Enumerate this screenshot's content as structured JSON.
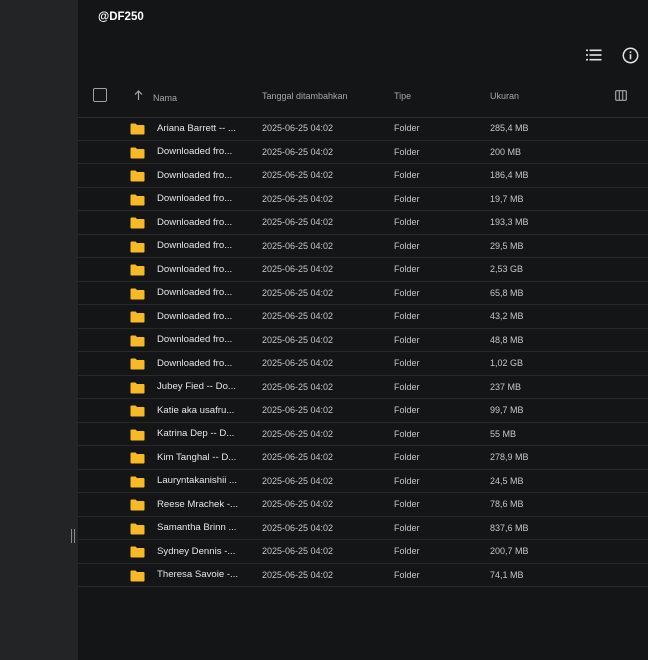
{
  "title": "@DF250",
  "header": {
    "name": "Nama",
    "date": "Tanggal ditambahkan",
    "type": "Tipe",
    "size": "Ukuran"
  },
  "icons": {
    "list_view": "list-icon",
    "info": "info-icon",
    "sort": "arrow-up-icon",
    "columns": "columns-icon",
    "folder": "folder-icon",
    "folder_color": "#f7b924"
  },
  "rows": [
    {
      "name": "Ariana Barrett -- ...",
      "date": "2025-06-25 04:02",
      "type": "Folder",
      "size": "285,4 MB"
    },
    {
      "name": "Downloaded fro...",
      "date": "2025-06-25 04:02",
      "type": "Folder",
      "size": "200 MB"
    },
    {
      "name": "Downloaded fro...",
      "date": "2025-06-25 04:02",
      "type": "Folder",
      "size": "186,4 MB"
    },
    {
      "name": "Downloaded fro...",
      "date": "2025-06-25 04:02",
      "type": "Folder",
      "size": "19,7 MB"
    },
    {
      "name": "Downloaded fro...",
      "date": "2025-06-25 04:02",
      "type": "Folder",
      "size": "193,3 MB"
    },
    {
      "name": "Downloaded fro...",
      "date": "2025-06-25 04:02",
      "type": "Folder",
      "size": "29,5 MB"
    },
    {
      "name": "Downloaded fro...",
      "date": "2025-06-25 04:02",
      "type": "Folder",
      "size": "2,53 GB"
    },
    {
      "name": "Downloaded fro...",
      "date": "2025-06-25 04:02",
      "type": "Folder",
      "size": "65,8 MB"
    },
    {
      "name": "Downloaded fro...",
      "date": "2025-06-25 04:02",
      "type": "Folder",
      "size": "43,2 MB"
    },
    {
      "name": "Downloaded fro...",
      "date": "2025-06-25 04:02",
      "type": "Folder",
      "size": "48,8 MB"
    },
    {
      "name": "Downloaded fro...",
      "date": "2025-06-25 04:02",
      "type": "Folder",
      "size": "1,02 GB"
    },
    {
      "name": "Jubey Fied -- Do...",
      "date": "2025-06-25 04:02",
      "type": "Folder",
      "size": "237 MB"
    },
    {
      "name": "Katie aka usafru...",
      "date": "2025-06-25 04:02",
      "type": "Folder",
      "size": "99,7 MB"
    },
    {
      "name": "Katrina Dep -- D...",
      "date": "2025-06-25 04:02",
      "type": "Folder",
      "size": "55 MB"
    },
    {
      "name": "Kim Tanghal -- D...",
      "date": "2025-06-25 04:02",
      "type": "Folder",
      "size": "278,9 MB"
    },
    {
      "name": "Lauryntakanishii ...",
      "date": "2025-06-25 04:02",
      "type": "Folder",
      "size": "24,5 MB"
    },
    {
      "name": "Reese Mrachek -...",
      "date": "2025-06-25 04:02",
      "type": "Folder",
      "size": "78,6 MB"
    },
    {
      "name": "Samantha Brinn ...",
      "date": "2025-06-25 04:02",
      "type": "Folder",
      "size": "837,6 MB"
    },
    {
      "name": "Sydney Dennis -...",
      "date": "2025-06-25 04:02",
      "type": "Folder",
      "size": "200,7 MB"
    },
    {
      "name": "Theresa Savoie -...",
      "date": "2025-06-25 04:02",
      "type": "Folder",
      "size": "74,1 MB"
    }
  ]
}
